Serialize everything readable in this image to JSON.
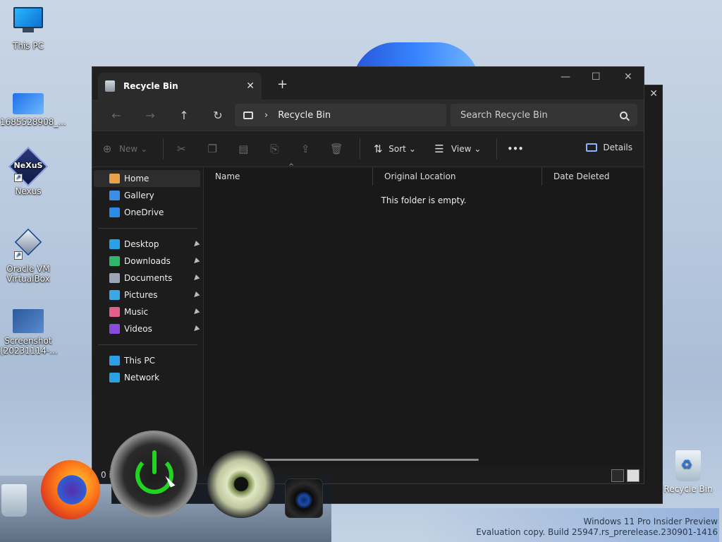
{
  "desktop": {
    "icons": [
      {
        "label": "This PC"
      },
      {
        "label": "1685528908_..."
      },
      {
        "label": "Nexus"
      },
      {
        "label": "Oracle VM VirtualBox"
      },
      {
        "label": "Screenshot (20231114-..."
      }
    ],
    "recycle_bin_label": "Recycle Bin",
    "nexus_logo": "NeXuS"
  },
  "window": {
    "tab_title": "Recycle Bin",
    "tab_close": "✕",
    "new_tab": "+",
    "controls": {
      "minimize": "—",
      "maximize": "☐",
      "close": "✕"
    },
    "nav": {
      "back": "←",
      "forward": "→",
      "up": "↑",
      "refresh": "↻"
    },
    "address": {
      "chevron": "›",
      "location": "Recycle Bin"
    },
    "search": {
      "placeholder": "Search Recycle Bin"
    },
    "toolbar": {
      "new_label": "New",
      "sort_label": "Sort",
      "view_label": "View",
      "more_label": "•••",
      "details_label": "Details",
      "caret": "⌄"
    },
    "sidebar": {
      "groups": [
        [
          {
            "label": "Home",
            "icon": "home-icon",
            "color": "#e8a24a"
          },
          {
            "label": "Gallery",
            "icon": "gallery-icon",
            "color": "#3a8ee6"
          },
          {
            "label": "OneDrive",
            "icon": "onedrive-icon",
            "color": "#2b8ae6"
          }
        ],
        [
          {
            "label": "Desktop",
            "icon": "desktop-icon",
            "color": "#2aa0e6",
            "pinned": true
          },
          {
            "label": "Downloads",
            "icon": "download-icon",
            "color": "#2fb86c",
            "pinned": true
          },
          {
            "label": "Documents",
            "icon": "documents-icon",
            "color": "#9aa6b8",
            "pinned": true
          },
          {
            "label": "Pictures",
            "icon": "pictures-icon",
            "color": "#3aa8e8",
            "pinned": true
          },
          {
            "label": "Music",
            "icon": "music-icon",
            "color": "#e0608a",
            "pinned": true
          },
          {
            "label": "Videos",
            "icon": "videos-icon",
            "color": "#8a4ae0",
            "pinned": true
          }
        ],
        [
          {
            "label": "This PC",
            "icon": "this-pc-icon",
            "color": "#2aa0e6"
          },
          {
            "label": "Network",
            "icon": "network-icon",
            "color": "#2aa0e6"
          }
        ]
      ],
      "pin_glyph": "📌"
    },
    "columns": {
      "name": "Name",
      "location": "Original Location",
      "date": "Date Deleted",
      "sort_indicator": "^"
    },
    "empty_message": "This folder is empty.",
    "status_text": "0 it"
  },
  "watermark": {
    "line1": "Windows 11 Pro Insider Preview",
    "line2": "Evaluation copy. Build 25947.rs_prerelease.230901-1416"
  }
}
